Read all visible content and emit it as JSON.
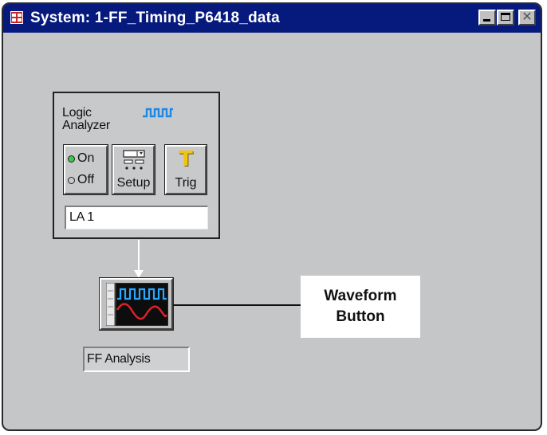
{
  "window": {
    "title": "System:  1-FF_Timing_P6418_data",
    "controls": [
      "minimize",
      "maximize",
      "close"
    ]
  },
  "logic_analyzer": {
    "name": "Logic\nAnalyzer",
    "on_label": "On",
    "off_label": "Off",
    "selected": "On",
    "setup_label": "Setup",
    "trig_label": "Trig",
    "trig_glyph": "T",
    "instance_name": "LA 1"
  },
  "waveform": {
    "window_name": "FF Analysis"
  },
  "callout": {
    "text": "Waveform\nButton"
  },
  "colors": {
    "titlebar": "#06197d",
    "desktop": "#c5c6c8",
    "on_indicator": "#3ecb44",
    "trig_icon": "#f2c40a",
    "wave_blue": "#2aa7ff",
    "wave_red": "#e0202a"
  }
}
